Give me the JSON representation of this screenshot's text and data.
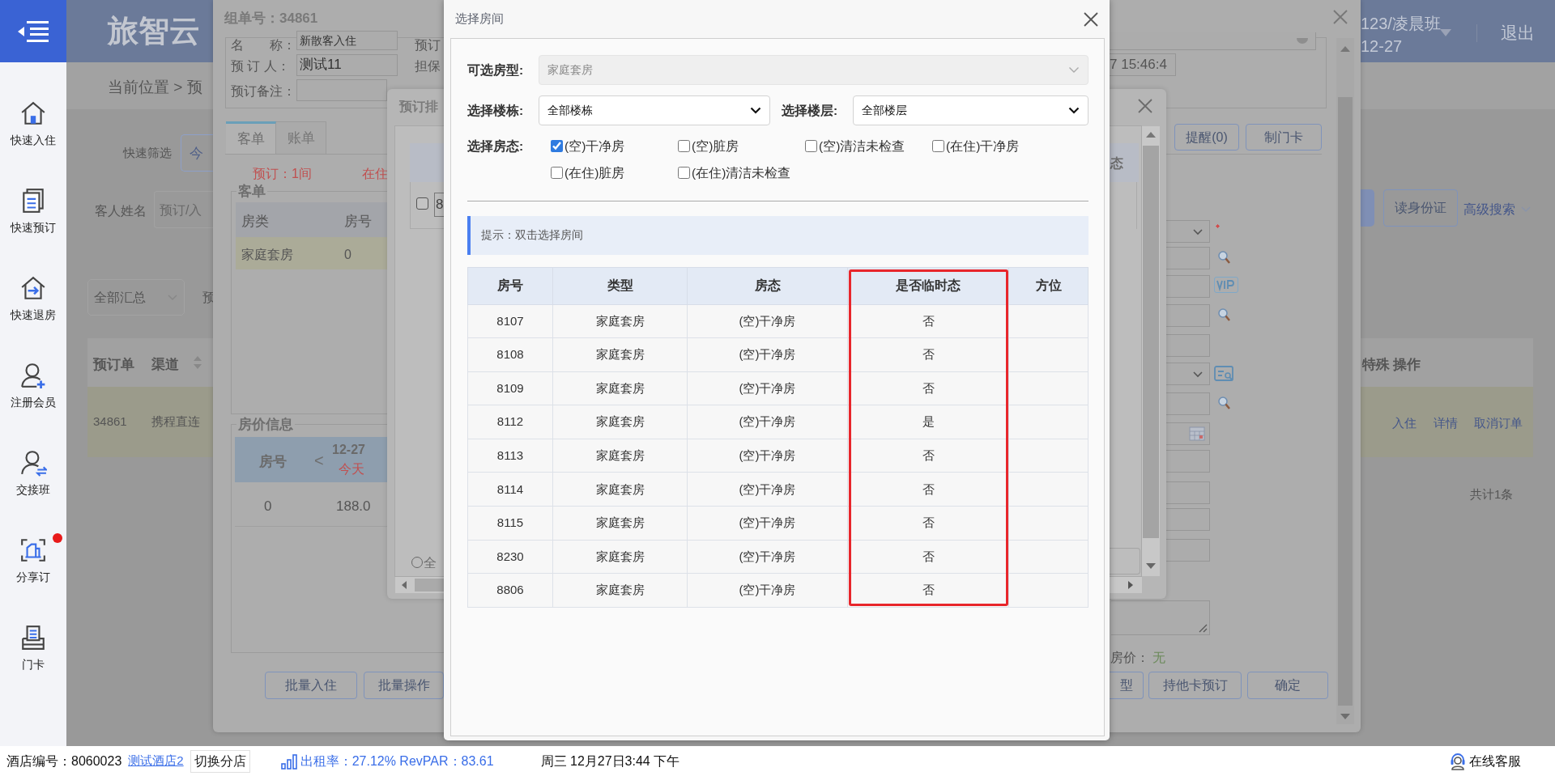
{
  "sidebar": {
    "items": [
      {
        "label": "快速入住",
        "badge": false
      },
      {
        "label": "快速预订",
        "badge": false
      },
      {
        "label": "快速退房",
        "badge": false
      },
      {
        "label": "注册会员",
        "badge": false
      },
      {
        "label": "交接班",
        "badge": false
      },
      {
        "label": "分享订",
        "badge": true
      },
      {
        "label": "门卡",
        "badge": false
      }
    ]
  },
  "header": {
    "title": "旅智云",
    "user": "123/凌晨班",
    "date": "12-27",
    "logout": "退出"
  },
  "page": {
    "breadcrumb": "当前位置 > 预",
    "quick_filter_label": "快速筛选",
    "quick_filter_value": "今",
    "guest_name_label": "客人姓名",
    "guest_name_placeholder": "预订/入",
    "summary_select": "全部汇总",
    "column_3": "预",
    "id_button": "读身份证",
    "advanced_search": "高级搜索",
    "table": {
      "columns_left": [
        "预订单",
        "渠道"
      ],
      "columns_right": [
        "特殊",
        "操作"
      ],
      "rows": [
        {
          "cells": [
            "34861",
            "携程直连"
          ],
          "actions": [
            "入住",
            "详情",
            "取消订单"
          ]
        }
      ]
    },
    "total": "共计1条"
  },
  "order_window": {
    "title": "组单号：34861",
    "fields": [
      {
        "label": "名　　称：",
        "value": "新散客入住"
      },
      {
        "label": "预 订 人：",
        "value": "测试11"
      },
      {
        "label": "预订备注："
      }
    ],
    "field_labels_right": [
      "预订",
      "担保"
    ],
    "time_value": "7 15:46:4",
    "tabs": [
      {
        "label": "客单",
        "selected": true
      },
      {
        "label": "账单",
        "selected": false
      }
    ],
    "counts": [
      "预订：1间",
      "在住"
    ],
    "guest_section": {
      "legend": "客单",
      "columns": [
        "房类",
        "房号"
      ],
      "rows": [
        [
          "家庭套房",
          "0"
        ]
      ]
    },
    "price_section": {
      "legend": "房价信息",
      "room_column": "房号",
      "prev": "<",
      "date": "12-27",
      "date_note": "今天",
      "rows": [
        [
          "0",
          "188.0"
        ]
      ]
    },
    "buttons_left": [
      "批量入住",
      "批量操作"
    ],
    "buttons_top": [
      "提醒(0)",
      "制门卡"
    ],
    "price_label": "房价：",
    "price_value": "无",
    "buttons_right": [
      "型",
      "持他卡预订",
      "确定"
    ]
  },
  "arrange_window": {
    "title": "预订排",
    "column_partial": "态",
    "row_value": "8",
    "row_checked": false,
    "radio_label": "全",
    "radio_selected": false
  },
  "room_dialog": {
    "title": "选择房间",
    "room_type": {
      "label": "可选房型:",
      "value": "家庭套房",
      "disabled": true
    },
    "building": {
      "label": "选择楼栋:",
      "value": "全部楼栋"
    },
    "floor": {
      "label": "选择楼层:",
      "value": "全部楼层"
    },
    "status_label": "选择房态:",
    "statuses": [
      {
        "label": "(空)干净房",
        "checked": true
      },
      {
        "label": "(空)脏房",
        "checked": false
      },
      {
        "label": "(空)清洁未检查",
        "checked": false
      },
      {
        "label": "(在住)干净房",
        "checked": false
      },
      {
        "label": "(在住)脏房",
        "checked": false
      },
      {
        "label": "(在住)清洁未检查",
        "checked": false
      }
    ],
    "hint": "提示：双击选择房间",
    "columns": [
      {
        "label": "房号",
        "highlighted": false
      },
      {
        "label": "类型",
        "highlighted": false
      },
      {
        "label": "房态",
        "highlighted": false
      },
      {
        "label": "是否临时态",
        "highlighted": true
      },
      {
        "label": "方位",
        "highlighted": false
      }
    ],
    "rows": [
      {
        "cells": [
          "8107",
          "家庭套房",
          "(空)干净房",
          "否"
        ]
      },
      {
        "cells": [
          "8108",
          "家庭套房",
          "(空)干净房",
          "否"
        ]
      },
      {
        "cells": [
          "8109",
          "家庭套房",
          "(空)干净房",
          "否"
        ]
      },
      {
        "cells": [
          "8112",
          "家庭套房",
          "(空)干净房",
          "是"
        ]
      },
      {
        "cells": [
          "8113",
          "家庭套房",
          "(空)干净房",
          "否"
        ]
      },
      {
        "cells": [
          "8114",
          "家庭套房",
          "(空)干净房",
          "否"
        ]
      },
      {
        "cells": [
          "8115",
          "家庭套房",
          "(空)干净房",
          "否"
        ]
      },
      {
        "cells": [
          "8230",
          "家庭套房",
          "(空)干净房",
          "否"
        ]
      },
      {
        "cells": [
          "8806",
          "家庭套房",
          "(空)干净房",
          "否"
        ]
      }
    ]
  },
  "status_bar": {
    "hotel_label": "酒店编号：8060023",
    "hotel_name": "测试酒店2",
    "switch": "切换分店",
    "occupancy": "出租率：27.12% RevPAR：83.61",
    "datetime": "周三 12月27日3:44 下午",
    "support": "在线客服"
  }
}
